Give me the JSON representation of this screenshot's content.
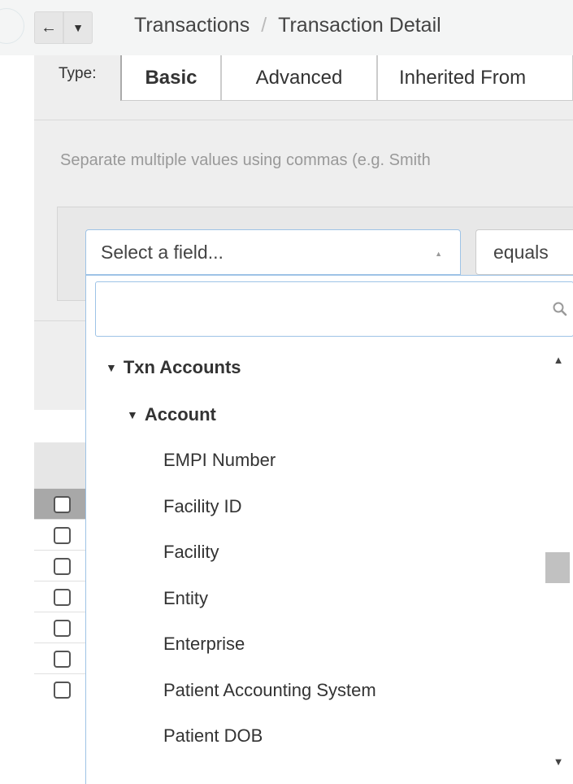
{
  "header": {
    "back_icon": "arrow-left-icon",
    "menu_icon": "caret-down-icon",
    "breadcrumb": [
      "Transactions",
      "Transaction Detail"
    ],
    "separator": "/"
  },
  "filter": {
    "type_label": "Type:",
    "tabs": [
      {
        "label": "Basic",
        "active": true
      },
      {
        "label": "Advanced",
        "active": false
      },
      {
        "label": "Inherited From",
        "active": false
      }
    ],
    "hint": "Separate multiple values using commas (e.g. Smith"
  },
  "criteria": {
    "field_placeholder": "Select a field...",
    "operator": "equals"
  },
  "dropdown": {
    "search_value": "",
    "search_icon": "search-icon",
    "groups": [
      {
        "label": "Txn Accounts",
        "level": 0,
        "expanded": true
      },
      {
        "label": "Account",
        "level": 1,
        "expanded": true
      }
    ],
    "items": [
      "EMPI Number",
      "Facility ID",
      "Facility",
      "Entity",
      "Enterprise",
      "Patient Accounting System",
      "Patient DOB"
    ],
    "scroll_position": 0.5
  },
  "table": {
    "rows": [
      {
        "checked": false,
        "selected": true
      },
      {
        "checked": false,
        "selected": false
      },
      {
        "checked": false,
        "selected": false
      },
      {
        "checked": false,
        "selected": false
      },
      {
        "checked": false,
        "selected": false
      },
      {
        "checked": false,
        "selected": false
      },
      {
        "checked": false,
        "selected": false
      }
    ]
  },
  "colors": {
    "focus_border": "#9ec3e6",
    "panel_bg": "#eeeeee",
    "hint_text": "#999999",
    "selected_row": "#a8a8a8"
  }
}
